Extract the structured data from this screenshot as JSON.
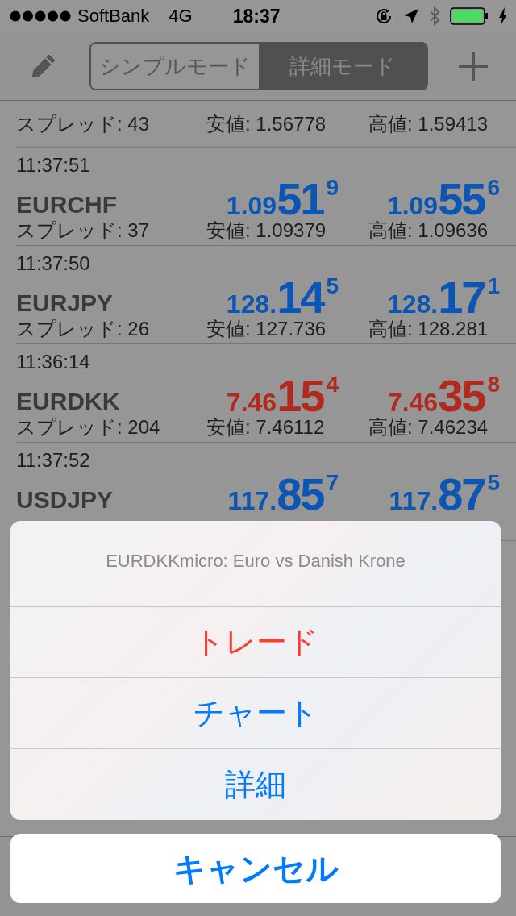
{
  "status_bar": {
    "carrier": "SoftBank",
    "network": "4G",
    "time": "18:37"
  },
  "nav": {
    "segments": [
      {
        "label": "シンプルモード",
        "selected": false
      },
      {
        "label": "詳細モード",
        "selected": true
      }
    ]
  },
  "quotes": [
    {
      "spread": "スプレッド: 43",
      "low": "安値: 1.56778",
      "high": "高値: 1.59413"
    },
    {
      "time": "11:37:51",
      "symbol": "EURCHF",
      "color": "#0b55b4",
      "bid": {
        "prefix": "1.09",
        "big": "51",
        "pip": "9"
      },
      "ask": {
        "prefix": "1.09",
        "big": "55",
        "pip": "6"
      },
      "spread": "スプレッド: 37",
      "low": "安値: 1.09379",
      "high": "高値: 1.09636"
    },
    {
      "time": "11:37:50",
      "symbol": "EURJPY",
      "color": "#0b55b4",
      "bid": {
        "prefix": "128.",
        "big": "14",
        "pip": "5"
      },
      "ask": {
        "prefix": "128.",
        "big": "17",
        "pip": "1"
      },
      "spread": "スプレッド: 26",
      "low": "安値: 127.736",
      "high": "高値: 128.281"
    },
    {
      "time": "11:36:14",
      "symbol": "EURDKK",
      "color": "#b02a20",
      "bid": {
        "prefix": "7.46",
        "big": "15",
        "pip": "4"
      },
      "ask": {
        "prefix": "7.46",
        "big": "35",
        "pip": "8"
      },
      "spread": "スプレッド: 204",
      "low": "安値: 7.46112",
      "high": "高値: 7.46234"
    },
    {
      "time": "11:37:52",
      "symbol": "USDJPY",
      "color": "#0b55b4",
      "bid": {
        "prefix": "117.",
        "big": "85",
        "pip": "7"
      },
      "ask": {
        "prefix": "117.",
        "big": "87",
        "pip": "5"
      }
    }
  ],
  "action_sheet": {
    "title": "EURDKKmicro: Euro vs Danish Krone",
    "actions": [
      {
        "label": "トレード",
        "kind": "destructive"
      },
      {
        "label": "チャート",
        "kind": "default"
      },
      {
        "label": "詳細",
        "kind": "default"
      }
    ],
    "cancel": "キャンセル"
  }
}
